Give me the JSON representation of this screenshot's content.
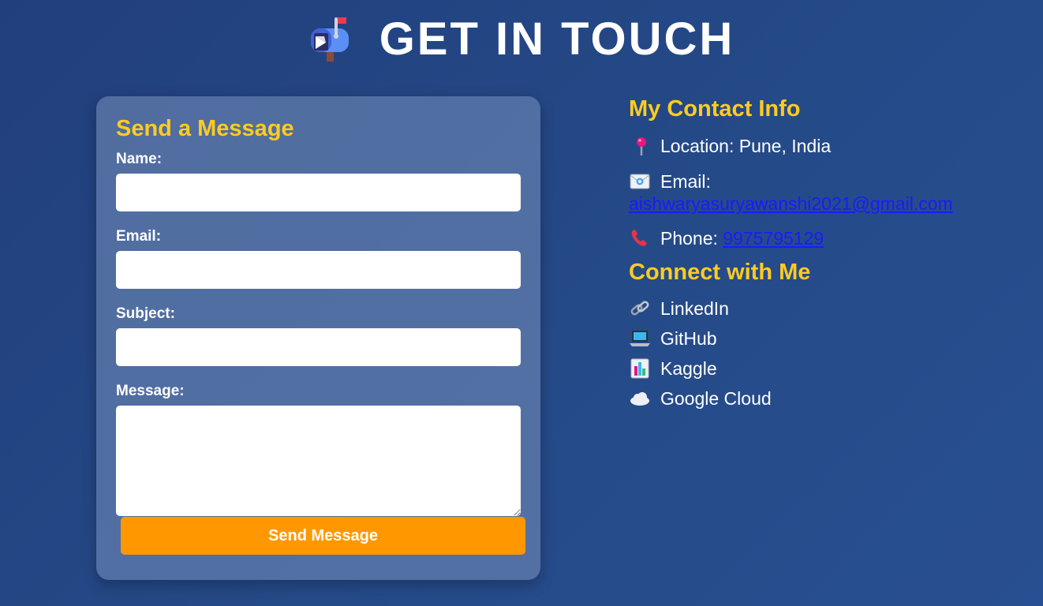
{
  "header": {
    "title": "GET IN TOUCH",
    "icon": "mailbox-with-flag-icon"
  },
  "form": {
    "title": "Send a Message",
    "fields": [
      {
        "label": "Name:",
        "value": "",
        "placeholder": ""
      },
      {
        "label": "Email:",
        "value": "",
        "placeholder": ""
      },
      {
        "label": "Subject:",
        "value": "",
        "placeholder": ""
      },
      {
        "label": "Message:",
        "value": "",
        "placeholder": ""
      }
    ],
    "submit_label": "Send Message"
  },
  "contact": {
    "title": "My Contact Info",
    "location_label": "Location: Pune, India",
    "email_label": "Email:",
    "email_value": "aishwaryasuryawanshi2021@gmail.com",
    "phone_label": "Phone:",
    "phone_value": "9975795129"
  },
  "connect": {
    "title": "Connect with Me",
    "links": [
      {
        "label": "LinkedIn",
        "icon": "link-icon"
      },
      {
        "label": "GitHub",
        "icon": "laptop-icon"
      },
      {
        "label": "Kaggle",
        "icon": "bar-chart-icon"
      },
      {
        "label": "Google Cloud",
        "icon": "cloud-icon"
      }
    ]
  },
  "colors": {
    "background": "#234584",
    "accent_yellow": "#ffcc1f",
    "button_orange": "#ff9800",
    "link_blue": "#1a1aff"
  }
}
